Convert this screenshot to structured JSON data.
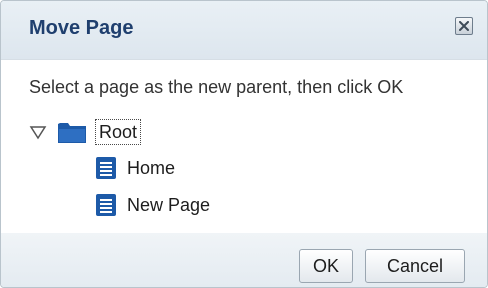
{
  "dialog": {
    "title": "Move Page",
    "close_icon": "close-icon",
    "instructions": "Select a page as the new parent, then click OK"
  },
  "tree": {
    "root": {
      "label": "Root",
      "expanded": true,
      "icon": "folder-icon",
      "children": [
        {
          "label": "Home",
          "icon": "page-icon"
        },
        {
          "label": "New Page",
          "icon": "page-icon"
        }
      ]
    }
  },
  "buttons": {
    "ok_label": "OK",
    "cancel_label": "Cancel"
  },
  "colors": {
    "title_text": "#1f3f6e",
    "icon_blue": "#1d5aa8",
    "titlebar_bg": "#e4ecf2"
  }
}
